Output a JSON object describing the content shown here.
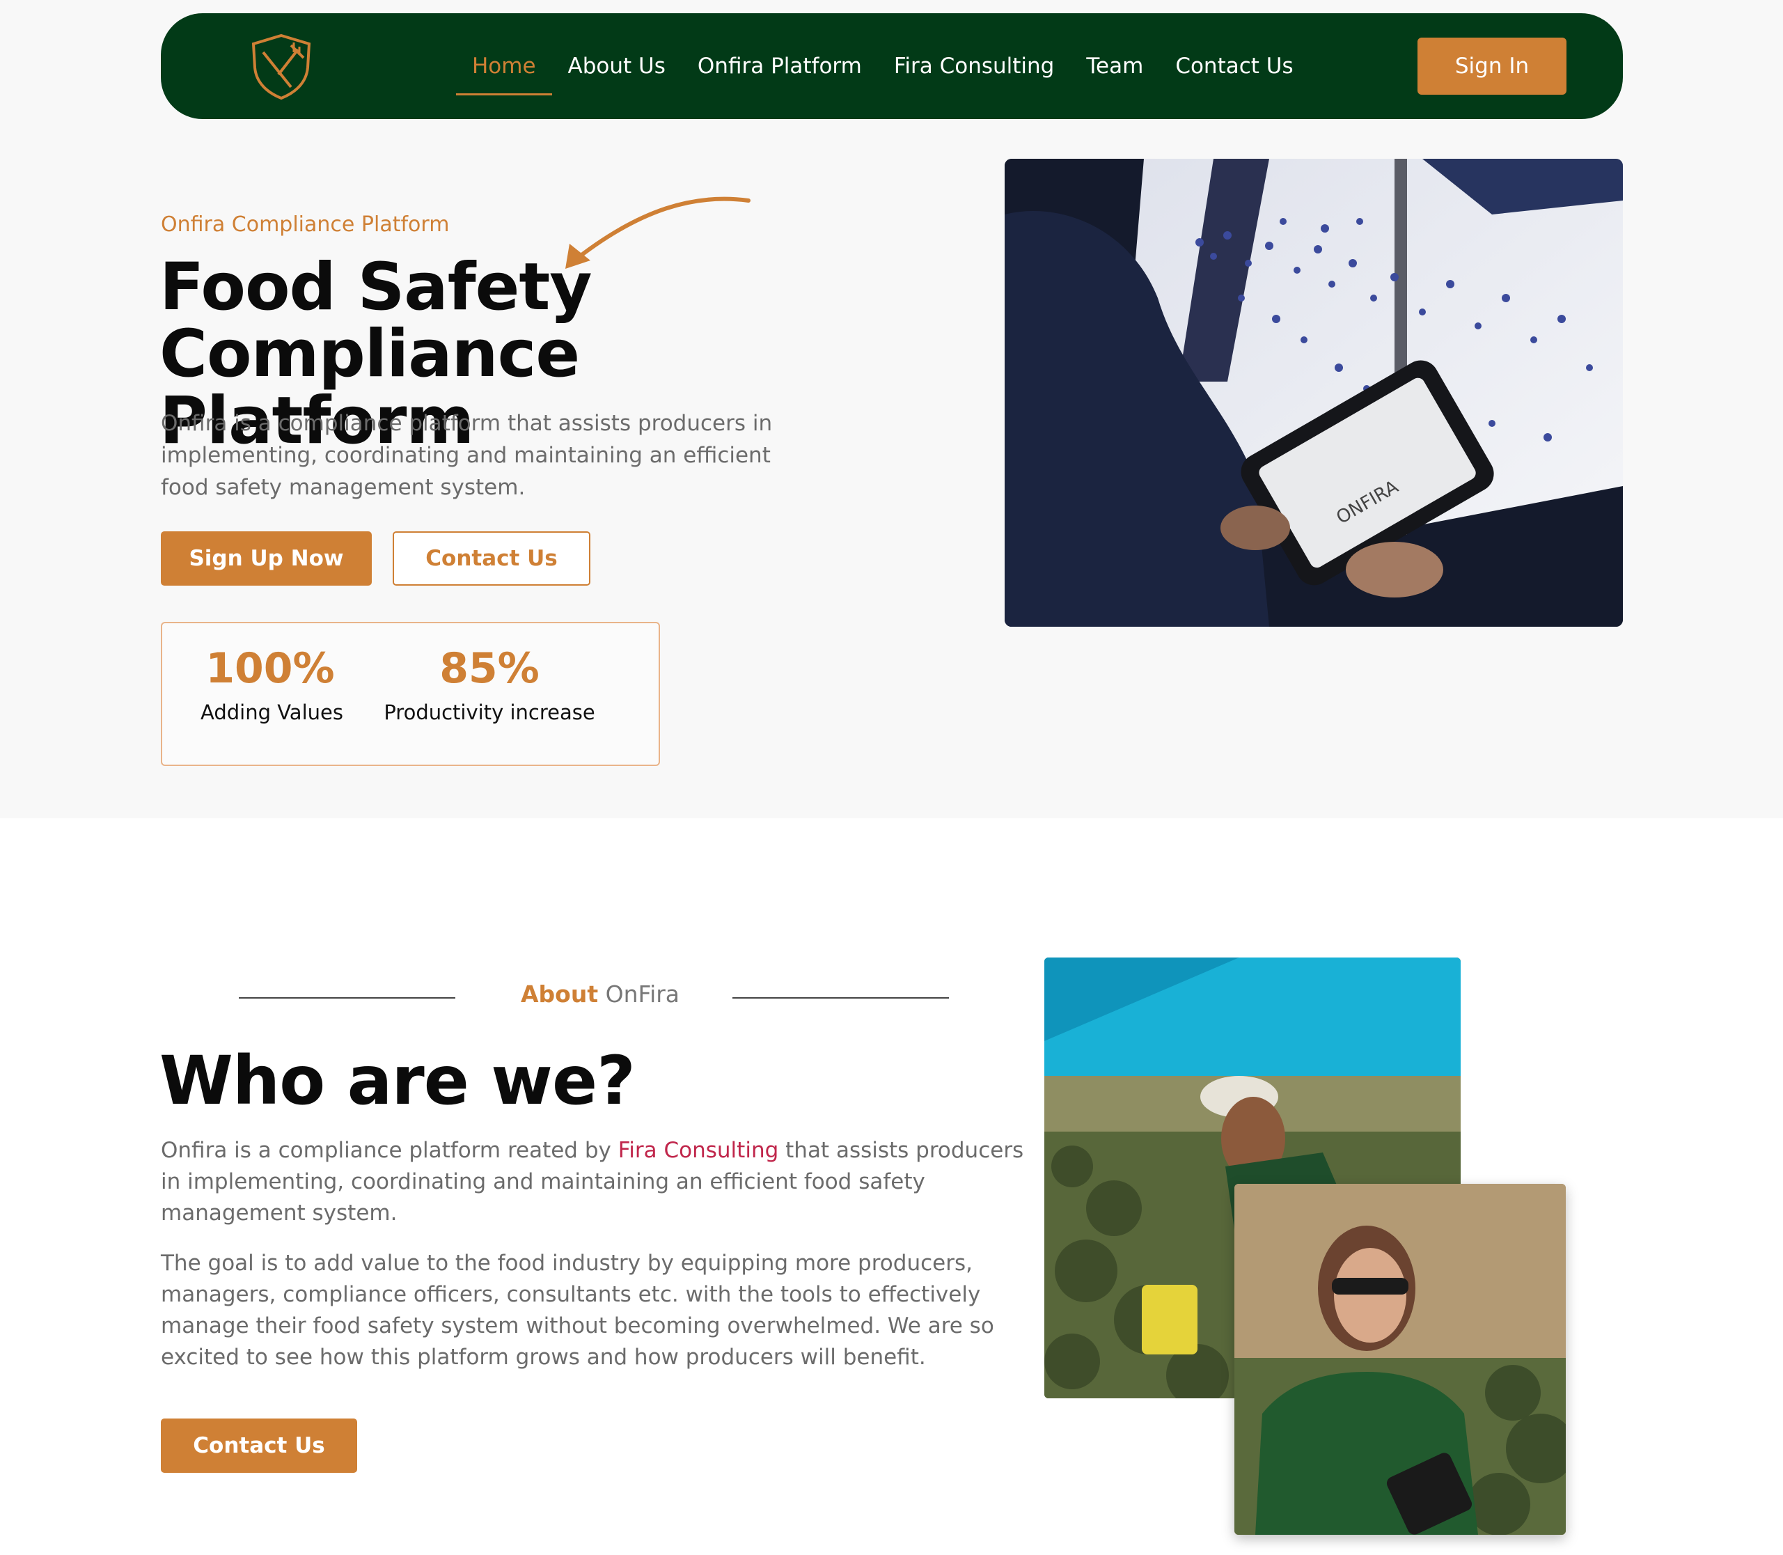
{
  "nav": {
    "items": [
      {
        "label": "Home",
        "active": true
      },
      {
        "label": "About Us"
      },
      {
        "label": "Onfira Platform"
      },
      {
        "label": "Fira Consulting"
      },
      {
        "label": "Team"
      },
      {
        "label": "Contact Us"
      }
    ],
    "signin_label": "Sign In",
    "logo_icon": "shield-fork-knife-icon"
  },
  "hero": {
    "eyebrow": "Onfira Compliance Platform",
    "title_line1": "Food Safety",
    "title_line2": "Compliance Platform",
    "description": "Onfira is a compliance platform that assists producers in implementing, coordinating and maintaining an efficient food safety management system.",
    "signup_label": "Sign Up Now",
    "contact_label": "Contact Us",
    "stats": [
      {
        "value": "100%",
        "label": "Adding Values"
      },
      {
        "value": "85%",
        "label": "Productivity increase"
      }
    ],
    "image_tablet_text": "ONFIRA"
  },
  "about": {
    "eyebrow_bold": "About",
    "eyebrow_rest": " OnFira",
    "title": "Who are we?",
    "p1_before": "Onfira is a compliance platform reated by ",
    "p1_link": "Fira Consulting",
    "p1_after": " that assists producers in implementing, coordinating and maintaining an efficient food safety management system.",
    "p2": "The goal is to add value to the food industry by equipping more producers, managers, compliance officers, consultants etc. with the tools to effectively manage their food safety system without becoming overwhelmed. We are so excited to see how this platform grows and how producers will benefit.",
    "contact_label": "Contact Us"
  },
  "colors": {
    "brand_green": "#023a17",
    "accent_orange": "#cf8035",
    "link_red": "#c0264b"
  }
}
